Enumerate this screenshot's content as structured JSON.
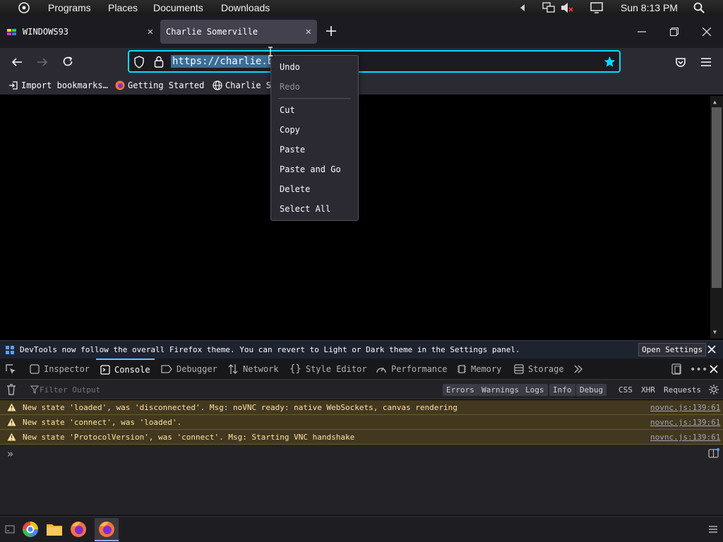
{
  "topbar": {
    "menu": [
      "Programs",
      "Places",
      "Documents",
      "Downloads"
    ],
    "clock": "Sun 8:13 PM"
  },
  "tabs": [
    {
      "label": "WINDOWS93"
    },
    {
      "label": "Charlie Somerville"
    }
  ],
  "navbar": {
    "url_visible": "https://charlie.bz"
  },
  "bookmarks": [
    "Import bookmarks…",
    "Getting Started",
    "Charlie S"
  ],
  "context_menu": {
    "items": [
      {
        "label": "Undo",
        "enabled": true
      },
      {
        "label": "Redo",
        "enabled": false
      },
      {
        "label": "Cut",
        "enabled": true
      },
      {
        "label": "Copy",
        "enabled": true
      },
      {
        "label": "Paste",
        "enabled": true
      },
      {
        "label": "Paste and Go",
        "enabled": true
      },
      {
        "label": "Delete",
        "enabled": true
      },
      {
        "label": "Select All",
        "enabled": true
      }
    ]
  },
  "devtools": {
    "notification": "DevTools now follow the overall Firefox theme. You can revert to Light or Dark theme in the Settings panel.",
    "notification_button": "Open Settings",
    "tabs": [
      "Inspector",
      "Console",
      "Debugger",
      "Network",
      "Style Editor",
      "Performance",
      "Memory",
      "Storage"
    ],
    "active_tab": "Console",
    "filter_placeholder": "Filter Output",
    "level_buttons": [
      "Errors",
      "Warnings",
      "Logs",
      "Info",
      "Debug"
    ],
    "type_buttons": [
      "CSS",
      "XHR",
      "Requests"
    ],
    "logs": [
      {
        "level": "warning",
        "message": "New state 'loaded', was 'disconnected'. Msg: noVNC ready: native WebSockets, canvas rendering",
        "source": "novnc.js:139:61"
      },
      {
        "level": "warning",
        "message": "New state 'connect', was 'loaded'.",
        "source": "novnc.js:139:61"
      },
      {
        "level": "warning",
        "message": "New state 'ProtocolVersion', was 'connect'. Msg: Starting VNC handshake",
        "source": "novnc.js:139:61"
      }
    ],
    "prompt": "»"
  },
  "colors": {
    "accent": "#00ddff",
    "warning_bg": "#42381f",
    "warning_text": "#fce2a1",
    "selection": "#3a6e96"
  }
}
